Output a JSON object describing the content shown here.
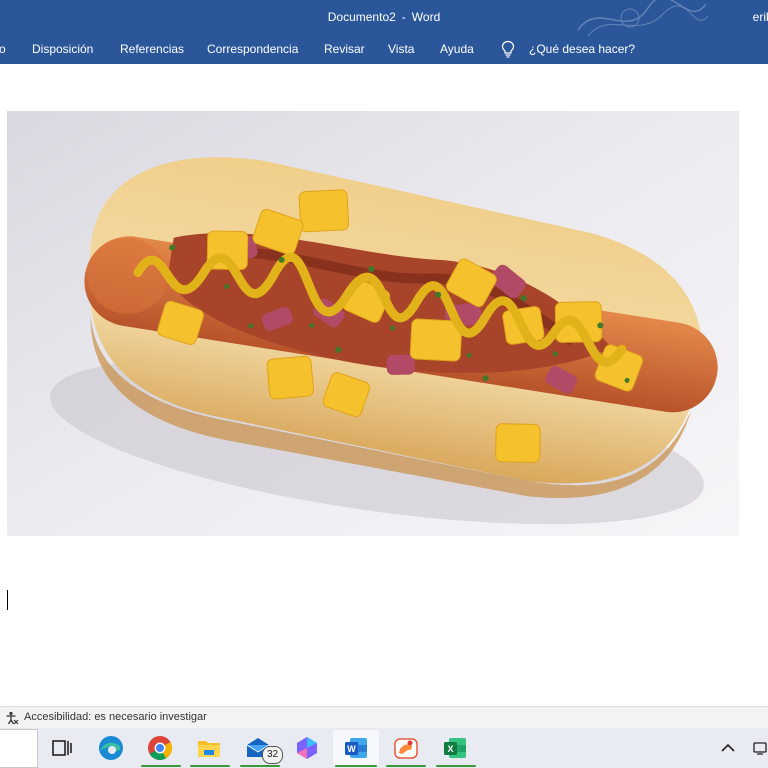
{
  "window": {
    "doc_name": "Documento2",
    "separator": "-",
    "app_name": "Word",
    "user": "erik"
  },
  "ribbon": {
    "tabs": [
      {
        "id": "archivo-partial",
        "label": "o"
      },
      {
        "id": "disposicion",
        "label": "Disposición"
      },
      {
        "id": "referencias",
        "label": "Referencias"
      },
      {
        "id": "correspondencia",
        "label": "Correspondencia"
      },
      {
        "id": "revisar",
        "label": "Revisar"
      },
      {
        "id": "vista",
        "label": "Vista"
      },
      {
        "id": "ayuda",
        "label": "Ayuda"
      }
    ],
    "tell_me": "¿Qué desea hacer?",
    "tell_me_icon": "lightbulb-icon"
  },
  "document": {
    "image": "hot-dog-photo",
    "cursor_visible": true
  },
  "status": {
    "accessibility": "Accesibilidad: es necesario investigar",
    "accessibility_icon": "accessibility-icon"
  },
  "taskbar": {
    "icons": [
      "task-view-icon",
      "edge-icon",
      "chrome-icon",
      "file-explorer-icon",
      "mail-icon",
      "copilot-icon",
      "word-icon",
      "paint-icon",
      "excel-icon"
    ],
    "mail_badge": "32"
  },
  "colors": {
    "ribbon": "#2b579a",
    "statusbar": "#f3f3f3",
    "taskbar": "#e8ecf2",
    "running_indicator": "#3a9a3a"
  }
}
